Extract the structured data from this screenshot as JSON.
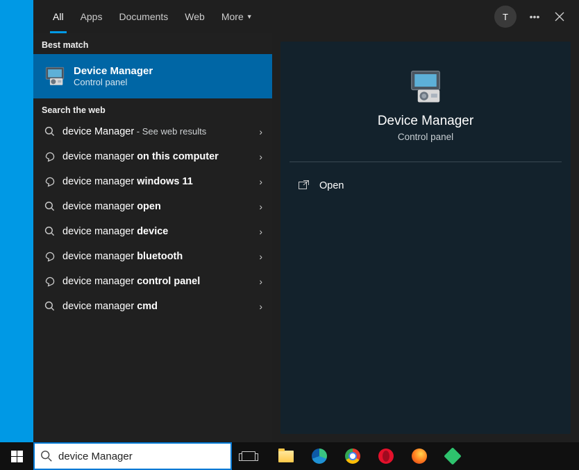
{
  "header": {
    "tabs": [
      "All",
      "Apps",
      "Documents",
      "Web",
      "More"
    ],
    "avatar_initial": "T"
  },
  "sections": {
    "best_match": "Best match",
    "search_web": "Search the web"
  },
  "best_result": {
    "title": "Device Manager",
    "subtitle": "Control panel"
  },
  "web_results": [
    {
      "prefix": "device Manager",
      "suffix": " - See web results",
      "bold": "",
      "type": "search"
    },
    {
      "prefix": "device manager ",
      "bold": "on this computer",
      "type": "faq"
    },
    {
      "prefix": "device manager ",
      "bold": "windows 11",
      "type": "faq"
    },
    {
      "prefix": "device manager ",
      "bold": "open",
      "type": "search"
    },
    {
      "prefix": "device manager ",
      "bold": "device",
      "type": "search"
    },
    {
      "prefix": "device manager ",
      "bold": "bluetooth",
      "type": "faq"
    },
    {
      "prefix": "device manager ",
      "bold": "control panel",
      "type": "faq"
    },
    {
      "prefix": "device manager ",
      "bold": "cmd",
      "type": "search"
    }
  ],
  "detail": {
    "title": "Device Manager",
    "subtitle": "Control panel",
    "actions": [
      {
        "label": "Open"
      }
    ]
  },
  "search_input": {
    "value": "device Manager"
  }
}
